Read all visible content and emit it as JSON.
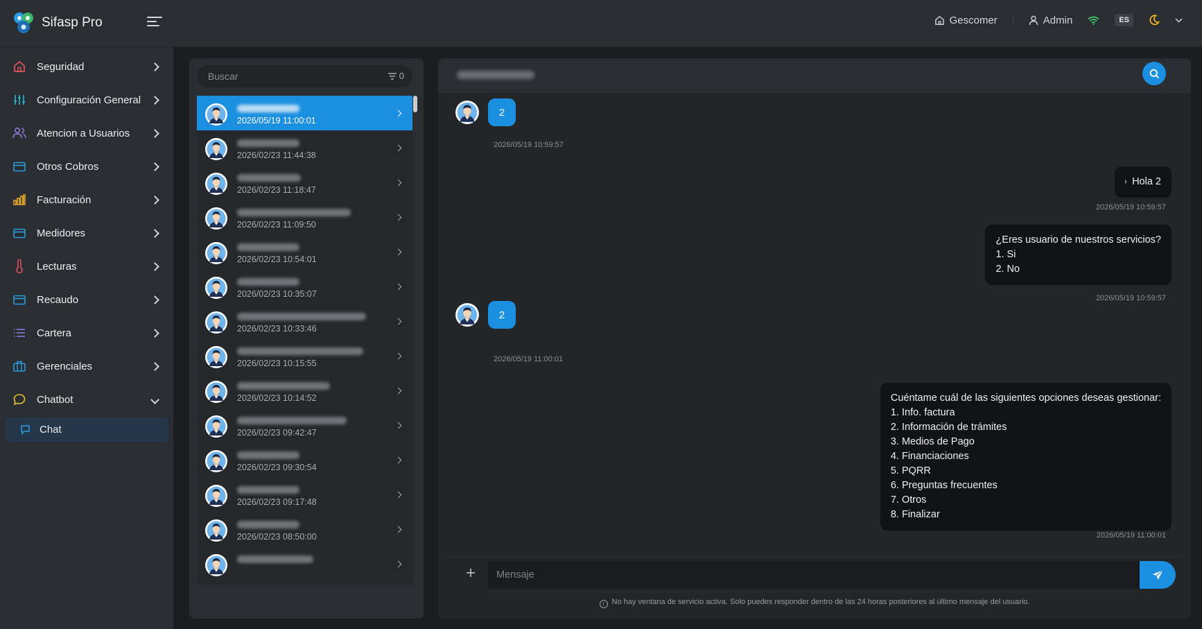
{
  "app": {
    "name": "Sifasp Pro"
  },
  "header": {
    "company": "Gescomer",
    "user": "Admin",
    "language": "ES"
  },
  "sidebar": {
    "items": [
      {
        "label": "Seguridad",
        "icon": "home-icon",
        "color": "#e0555a"
      },
      {
        "label": "Configuración General",
        "icon": "sliders-icon",
        "color": "#29b3c6"
      },
      {
        "label": "Atencion a Usuarios",
        "icon": "users-icon",
        "color": "#8e7ad8"
      },
      {
        "label": "Otros Cobros",
        "icon": "card-icon",
        "color": "#2a9de0"
      },
      {
        "label": "Facturación",
        "icon": "bar-chart-icon",
        "color": "#e3a52a"
      },
      {
        "label": "Medidores",
        "icon": "card-icon",
        "color": "#2a9de0"
      },
      {
        "label": "Lecturas",
        "icon": "thermometer-icon",
        "color": "#e0555a"
      },
      {
        "label": "Recaudo",
        "icon": "card-icon",
        "color": "#2a9de0"
      },
      {
        "label": "Cartera",
        "icon": "list-icon",
        "color": "#8e7ad8"
      },
      {
        "label": "Gerenciales",
        "icon": "briefcase-icon",
        "color": "#2a9de0"
      },
      {
        "label": "Chatbot",
        "icon": "chat-bubble-icon",
        "color": "#e3c22a"
      }
    ],
    "sub_item": {
      "label": "Chat",
      "icon": "chat-icon"
    }
  },
  "conversations": {
    "search_placeholder": "Buscar",
    "filter_count": "0",
    "items": [
      {
        "time": "2026/05/19 11:00:01",
        "active": true
      },
      {
        "time": "2026/02/23 11:44:38",
        "active": false
      },
      {
        "time": "2026/02/23 11:18:47",
        "active": false
      },
      {
        "time": "2026/02/23 11:09:50",
        "active": false
      },
      {
        "time": "2026/02/23 10:54:01",
        "active": false
      },
      {
        "time": "2026/02/23 10:35:07",
        "active": false
      },
      {
        "time": "2026/02/23 10:33:46",
        "active": false
      },
      {
        "time": "2026/02/23 10:15:55",
        "active": false
      },
      {
        "time": "2026/02/23 10:14:52",
        "active": false
      },
      {
        "time": "2026/02/23 09:42:47",
        "active": false
      },
      {
        "time": "2026/02/23 09:30:54",
        "active": false
      },
      {
        "time": "2026/02/23 09:17:48",
        "active": false
      },
      {
        "time": "2026/02/23 08:50:00",
        "active": false
      },
      {
        "time": "",
        "active": false
      }
    ]
  },
  "chat": {
    "messages": [
      {
        "from": "user",
        "text": "2",
        "time": "2026/05/19 10:59:57"
      },
      {
        "from": "bot",
        "lines": [
          "Hola 2"
        ],
        "time": "2026/05/19 10:59:57"
      },
      {
        "from": "bot",
        "lines": [
          "¿Eres usuario de nuestros servicios?",
          "1. Si",
          "2. No"
        ],
        "time": "2026/05/19 10:59:57"
      },
      {
        "from": "user",
        "text": "2",
        "time": "2026/05/19 11:00:01"
      },
      {
        "from": "bot",
        "lines": [
          "Cuéntame cuál de las siguientes opciones deseas gestionar:",
          "1. Info. factura",
          "2. Información de trámites",
          "3. Medios de Pago",
          "4. Financiaciones",
          "5. PQRR",
          "6. Preguntas frecuentes",
          "7. Otros",
          "8. Finalizar"
        ],
        "time": "2026/05/19 11:00:01"
      }
    ],
    "composer_placeholder": "Mensaje",
    "notice": "No hay ventana de servicio activa. Solo puedes responder dentro de las 24 horas posteriores al último mensaje del usuario."
  },
  "colors": {
    "accent": "#1b8fe0",
    "background": "#1b1d20",
    "panel": "#2a2d31"
  }
}
